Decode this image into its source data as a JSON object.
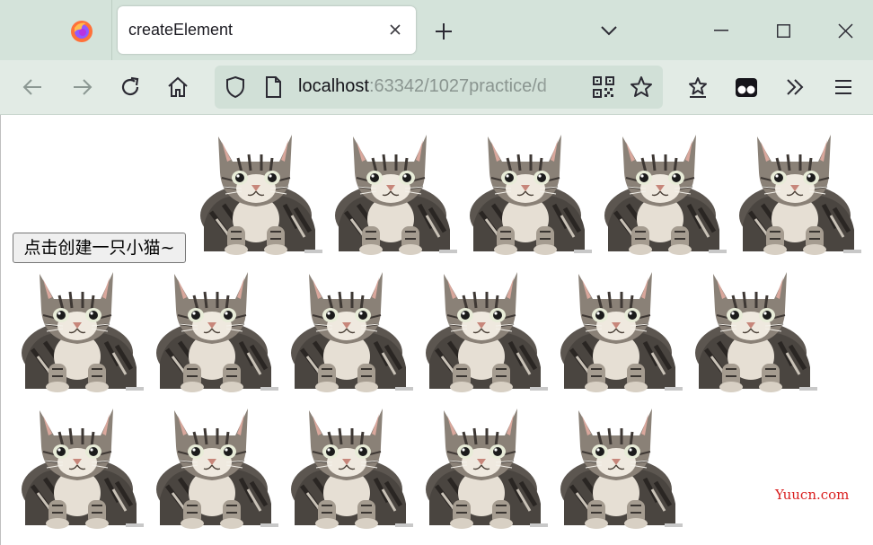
{
  "browser": {
    "tab_title": "createElement",
    "url_host": "localhost",
    "url_rest": ":63342/1027practice/d"
  },
  "page": {
    "button_label": "点击创建一只小猫~",
    "cat_count": 16,
    "watermark": "Yuucn.com"
  },
  "colors": {
    "tabstrip": "#d4e3da",
    "navbar": "#e2ebe5",
    "urlbar": "#d1e0d7",
    "watermark": "#d91e1e"
  },
  "icons": [
    "firefox-logo-icon",
    "close-icon",
    "plus-icon",
    "chevron-down-icon",
    "minimize-icon",
    "maximize-icon",
    "window-close-icon",
    "back-arrow-icon",
    "forward-arrow-icon",
    "reload-icon",
    "home-icon",
    "shield-icon",
    "page-icon",
    "qr-code-icon",
    "star-icon",
    "extension-icon",
    "glasses-icon",
    "overflow-icon",
    "menu-icon"
  ]
}
